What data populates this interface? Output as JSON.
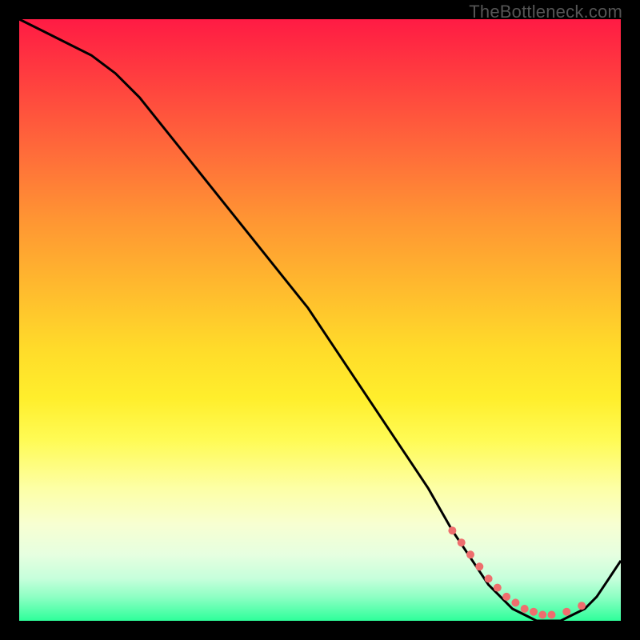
{
  "watermark": "TheBottleneck.com",
  "colors": {
    "curve": "#000000",
    "markers": "#ee6e6e",
    "gradient_top": "#ff1b44",
    "gradient_bottom": "#2eff9a"
  },
  "chart_data": {
    "type": "line",
    "title": "",
    "xlabel": "",
    "ylabel": "",
    "xlim": [
      0,
      100
    ],
    "ylim": [
      0,
      100
    ],
    "x": [
      0,
      4,
      8,
      12,
      16,
      20,
      24,
      28,
      32,
      36,
      40,
      44,
      48,
      52,
      56,
      60,
      64,
      68,
      72,
      74,
      76,
      78,
      80,
      82,
      84,
      86,
      88,
      90,
      92,
      94,
      96,
      98,
      100
    ],
    "values": [
      100,
      98,
      96,
      94,
      91,
      87,
      82,
      77,
      72,
      67,
      62,
      57,
      52,
      46,
      40,
      34,
      28,
      22,
      15,
      12,
      9,
      6,
      4,
      2,
      1,
      0,
      0,
      0,
      1,
      2,
      4,
      7,
      10
    ],
    "note": "x/y are percent of plot width/height; y=0 is bottom of the gradient area",
    "marker_points_x": [
      72,
      73.5,
      75,
      76.5,
      78,
      79.5,
      81,
      82.5,
      84,
      85.5,
      87,
      88.5,
      91,
      93.5
    ],
    "marker_points_y": [
      15,
      13,
      11,
      9,
      7,
      5.5,
      4,
      3,
      2,
      1.5,
      1,
      1,
      1.5,
      2.5
    ],
    "marker_radius_px": 5
  }
}
